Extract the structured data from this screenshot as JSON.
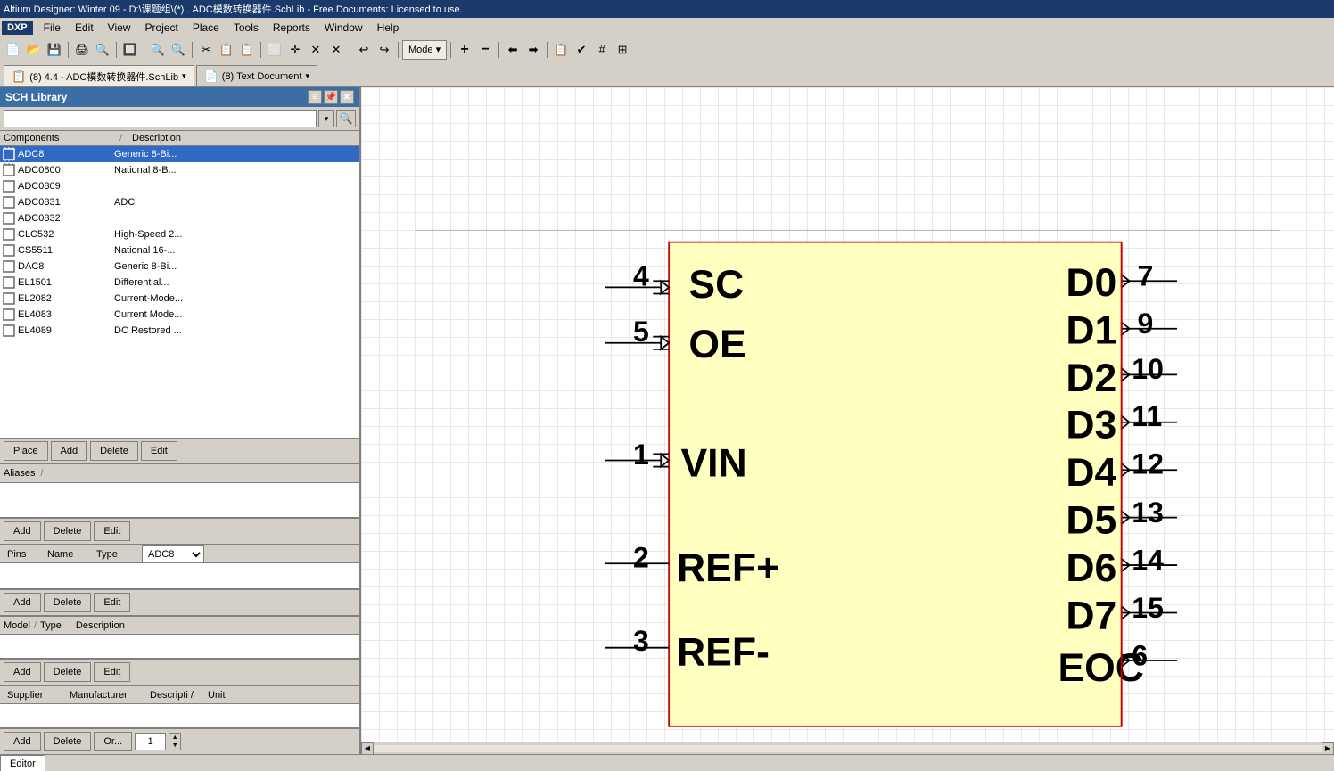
{
  "titlebar": {
    "text": "Altium Designer: Winter 09 - D:\\课题组\\(*)  . ADC模数转换器件.SchLib - Free Documents: Licensed to use."
  },
  "menubar": {
    "logo": "DXP",
    "items": [
      "File",
      "Edit",
      "View",
      "Project",
      "Place",
      "Tools",
      "Reports",
      "Window",
      "Help"
    ]
  },
  "toolbar": {
    "mode_label": "Mode ▾"
  },
  "doc_tabs": [
    {
      "icon": "📋",
      "label": "(8) 4.4 - ADC模数转换器件.SchLib",
      "active": true
    },
    {
      "icon": "📄",
      "label": "(8) Text Document",
      "active": false
    }
  ],
  "left_panel": {
    "title": "SCH Library",
    "search_placeholder": "",
    "components_header": {
      "col1": "Components",
      "slash": "/",
      "col2": "Description"
    },
    "components": [
      {
        "name": "ADC8",
        "desc": "Generic 8-Bi...",
        "selected": true
      },
      {
        "name": "ADC0800",
        "desc": "National 8-B..."
      },
      {
        "name": "ADC0809",
        "desc": ""
      },
      {
        "name": "ADC0831",
        "desc": "ADC"
      },
      {
        "name": "ADC0832",
        "desc": ""
      },
      {
        "name": "CLC532",
        "desc": "High-Speed 2..."
      },
      {
        "name": "CS5511",
        "desc": "National 16-..."
      },
      {
        "name": "DAC8",
        "desc": "Generic 8-Bi..."
      },
      {
        "name": "EL1501",
        "desc": "Differential..."
      },
      {
        "name": "EL2082",
        "desc": "Current-Mode..."
      },
      {
        "name": "EL4083",
        "desc": "Current Mode..."
      },
      {
        "name": "EL4089",
        "desc": "DC Restored ..."
      }
    ],
    "action_buttons": [
      "Place",
      "Add",
      "Delete",
      "Edit"
    ],
    "aliases_label": "Aliases",
    "aliases_slash": "/",
    "aliases_buttons": [
      "Add",
      "Delete",
      "Edit"
    ],
    "pins_header": {
      "cols": [
        "Pins",
        "Name",
        "Type",
        "ADC8"
      ]
    },
    "pins_buttons": [
      "Add",
      "Delete",
      "Edit"
    ],
    "model_header": {
      "cols": [
        "Model",
        "/",
        "Type",
        "Description"
      ]
    },
    "model_buttons": [
      "Add",
      "Delete",
      "Edit"
    ],
    "supplier_header": {
      "cols": [
        "Supplier",
        "Manufacturer",
        "Descripti /",
        "Unit"
      ]
    },
    "supplier_buttons": [
      "Add",
      "Delete",
      "Or...",
      "1"
    ]
  },
  "schematic": {
    "component_body": {
      "fill": "#ffffc0",
      "border": "#cc0000"
    },
    "pins_left": [
      {
        "num": "4",
        "name": "SC",
        "y_pct": 22
      },
      {
        "num": "5",
        "name": "OE",
        "y_pct": 30
      },
      {
        "num": "1",
        "name": "VIN",
        "y_pct": 48
      },
      {
        "num": "2",
        "name": "REF+",
        "y_pct": 64
      },
      {
        "num": "3",
        "name": "REF-",
        "y_pct": 80
      }
    ],
    "pins_right": [
      {
        "num": "7",
        "name": "D0",
        "y_pct": 22
      },
      {
        "num": "9",
        "name": "D1",
        "y_pct": 30
      },
      {
        "num": "10",
        "name": "D2",
        "y_pct": 38
      },
      {
        "num": "11",
        "name": "D3",
        "y_pct": 46
      },
      {
        "num": "12",
        "name": "D4",
        "y_pct": 54
      },
      {
        "num": "13",
        "name": "D5",
        "y_pct": 62
      },
      {
        "num": "14",
        "name": "D6",
        "y_pct": 70
      },
      {
        "num": "15",
        "name": "D7",
        "y_pct": 78
      },
      {
        "num": "6",
        "name": "EOC",
        "y_pct": 86
      }
    ],
    "left_labels": [
      "SC",
      "OE",
      "VIN",
      "REF+",
      "REF-"
    ],
    "right_labels": [
      "D0",
      "D1",
      "D2",
      "D3",
      "D4",
      "D5",
      "D6",
      "D7",
      "EOC"
    ]
  },
  "bottom_tabs": [
    "Editor"
  ]
}
